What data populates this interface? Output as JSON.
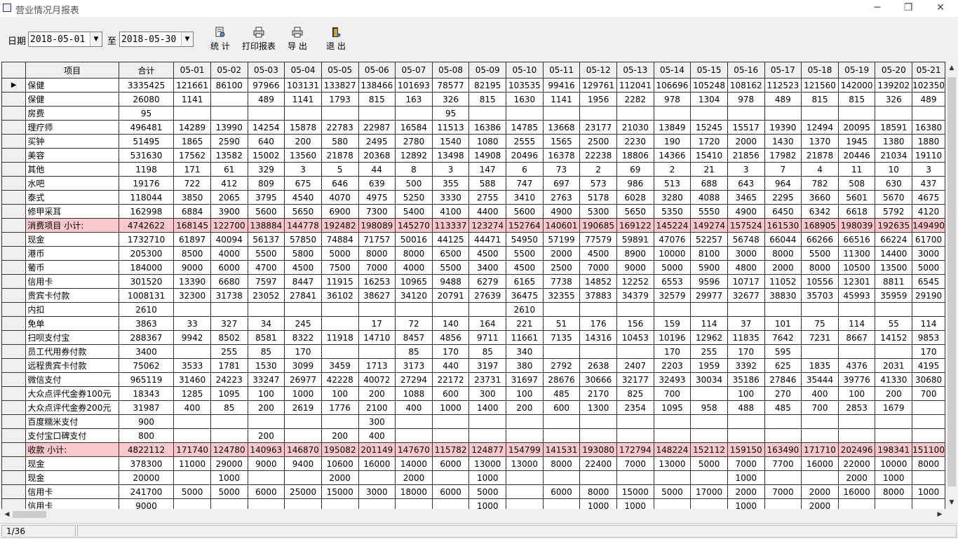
{
  "window": {
    "title": "营业情况月报表",
    "min_glyph": "─",
    "max_glyph": "❐",
    "close_glyph": "✕"
  },
  "toolbar": {
    "date_label": "日期",
    "to_label": "至",
    "start_date": "2018-05-01",
    "end_date": "2018-05-30",
    "stats_label": "统 计",
    "print_label": "打印报表",
    "export_label": "导 出",
    "exit_label": "退 出"
  },
  "table": {
    "headers": [
      "项目",
      "合计",
      "05-01",
      "05-02",
      "05-03",
      "05-04",
      "05-05",
      "05-06",
      "05-07",
      "05-08",
      "05-09",
      "05-10",
      "05-11",
      "05-12",
      "05-13",
      "05-14",
      "05-15",
      "05-16",
      "05-17",
      "05-18",
      "05-19",
      "05-20",
      "05-21"
    ],
    "current_row_marker": "▶",
    "rows": [
      {
        "name": "保健",
        "sub": false,
        "cells": [
          "3335425",
          "121661",
          "86100",
          "97966",
          "103131",
          "133827",
          "138466",
          "101693",
          "78577",
          "82195",
          "103535",
          "99416",
          "129761",
          "112041",
          "106696",
          "105248",
          "108162",
          "112523",
          "121560",
          "142000",
          "139202",
          "102350"
        ]
      },
      {
        "name": "保健",
        "sub": false,
        "cells": [
          "26080",
          "1141",
          "",
          "489",
          "1141",
          "1793",
          "815",
          "163",
          "326",
          "815",
          "1630",
          "1141",
          "1956",
          "2282",
          "978",
          "1304",
          "978",
          "489",
          "815",
          "815",
          "326",
          "489"
        ]
      },
      {
        "name": "房费",
        "sub": false,
        "cells": [
          "95",
          "",
          "",
          "",
          "",
          "",
          "",
          "",
          "95",
          "",
          "",
          "",
          "",
          "",
          "",
          "",
          "",
          "",
          "",
          "",
          "",
          ""
        ]
      },
      {
        "name": "理疗师",
        "sub": false,
        "cells": [
          "496481",
          "14289",
          "13990",
          "14254",
          "15878",
          "22783",
          "22987",
          "16584",
          "11513",
          "16386",
          "14785",
          "13668",
          "23177",
          "21030",
          "13849",
          "15245",
          "15517",
          "19390",
          "12494",
          "20095",
          "18591",
          "16380"
        ]
      },
      {
        "name": "买钟",
        "sub": false,
        "cells": [
          "51495",
          "1865",
          "2590",
          "640",
          "200",
          "580",
          "2495",
          "2780",
          "1540",
          "1080",
          "2555",
          "1565",
          "2500",
          "2230",
          "190",
          "1720",
          "2000",
          "1430",
          "1370",
          "1945",
          "1380",
          "1880"
        ]
      },
      {
        "name": "美容",
        "sub": false,
        "cells": [
          "531630",
          "17562",
          "13582",
          "15002",
          "13560",
          "21878",
          "20368",
          "12892",
          "13498",
          "14908",
          "20496",
          "16378",
          "22238",
          "18806",
          "14366",
          "15410",
          "21856",
          "17982",
          "21878",
          "20446",
          "21034",
          "19110"
        ]
      },
      {
        "name": "其他",
        "sub": false,
        "cells": [
          "1198",
          "171",
          "61",
          "329",
          "3",
          "5",
          "44",
          "8",
          "3",
          "147",
          "6",
          "73",
          "2",
          "69",
          "2",
          "21",
          "3",
          "7",
          "4",
          "11",
          "10",
          "3"
        ]
      },
      {
        "name": "水吧",
        "sub": false,
        "cells": [
          "19176",
          "722",
          "412",
          "809",
          "675",
          "646",
          "639",
          "500",
          "355",
          "588",
          "747",
          "697",
          "573",
          "986",
          "513",
          "688",
          "643",
          "964",
          "782",
          "508",
          "630",
          "437"
        ]
      },
      {
        "name": "泰式",
        "sub": false,
        "cells": [
          "118044",
          "3850",
          "2065",
          "3795",
          "4540",
          "4070",
          "4975",
          "5250",
          "3330",
          "2755",
          "3410",
          "2763",
          "5178",
          "6028",
          "3280",
          "4088",
          "3465",
          "2295",
          "3660",
          "5601",
          "5670",
          "4675"
        ]
      },
      {
        "name": "修甲采耳",
        "sub": false,
        "cells": [
          "162998",
          "6884",
          "3900",
          "5600",
          "5650",
          "6900",
          "7300",
          "5400",
          "4100",
          "4400",
          "5600",
          "4900",
          "5300",
          "5650",
          "5350",
          "5550",
          "4900",
          "6450",
          "6342",
          "6618",
          "5792",
          "4120"
        ]
      },
      {
        "name": "消费项目  小计:",
        "sub": true,
        "cells": [
          "4742622",
          "168145",
          "122700",
          "138884",
          "144778",
          "192482",
          "198089",
          "145270",
          "113337",
          "123274",
          "152764",
          "140601",
          "190685",
          "169122",
          "145224",
          "149274",
          "157524",
          "161530",
          "168905",
          "198039",
          "192635",
          "149490"
        ]
      },
      {
        "name": "现金",
        "sub": false,
        "cells": [
          "1732710",
          "61897",
          "40094",
          "56137",
          "57850",
          "74884",
          "71757",
          "50016",
          "44125",
          "44471",
          "54950",
          "57199",
          "77579",
          "59891",
          "47076",
          "52257",
          "56748",
          "66044",
          "66266",
          "66516",
          "66224",
          "61700"
        ]
      },
      {
        "name": "港币",
        "sub": false,
        "cells": [
          "205300",
          "8500",
          "4000",
          "5500",
          "5800",
          "5000",
          "8000",
          "8000",
          "6500",
          "4500",
          "5500",
          "2000",
          "4500",
          "8900",
          "10000",
          "8100",
          "3000",
          "8000",
          "5500",
          "11300",
          "14400",
          "3000"
        ]
      },
      {
        "name": "葡币",
        "sub": false,
        "cells": [
          "184000",
          "9000",
          "6000",
          "4700",
          "4500",
          "7500",
          "7000",
          "4000",
          "5500",
          "3400",
          "4500",
          "2500",
          "7000",
          "9000",
          "5000",
          "5900",
          "4800",
          "2000",
          "8000",
          "10500",
          "13500",
          "5000"
        ]
      },
      {
        "name": "信用卡",
        "sub": false,
        "cells": [
          "301520",
          "13390",
          "6680",
          "7597",
          "8447",
          "11915",
          "16253",
          "10965",
          "9488",
          "6279",
          "6165",
          "7738",
          "14852",
          "12252",
          "6553",
          "9596",
          "10717",
          "11052",
          "10556",
          "12301",
          "8811",
          "6545"
        ]
      },
      {
        "name": "贵宾卡付款",
        "sub": false,
        "cells": [
          "1008131",
          "32300",
          "31738",
          "23052",
          "27841",
          "36102",
          "38627",
          "34120",
          "20791",
          "27639",
          "36475",
          "32355",
          "37883",
          "34379",
          "32579",
          "29977",
          "32677",
          "38830",
          "35703",
          "45993",
          "35959",
          "29190"
        ]
      },
      {
        "name": "内扣",
        "sub": false,
        "cells": [
          "2610",
          "",
          "",
          "",
          "",
          "",
          "",
          "",
          "",
          "",
          "2610",
          "",
          "",
          "",
          "",
          "",
          "",
          "",
          "",
          "",
          "",
          ""
        ]
      },
      {
        "name": "免单",
        "sub": false,
        "cells": [
          "3863",
          "33",
          "327",
          "34",
          "245",
          "",
          "17",
          "72",
          "140",
          "164",
          "221",
          "51",
          "176",
          "156",
          "159",
          "114",
          "37",
          "101",
          "75",
          "114",
          "55",
          "114"
        ]
      },
      {
        "name": "扫呗支付宝",
        "sub": false,
        "cells": [
          "288367",
          "9942",
          "8502",
          "8581",
          "8322",
          "11918",
          "14710",
          "8457",
          "4856",
          "9711",
          "11661",
          "7135",
          "14316",
          "10453",
          "10196",
          "12962",
          "11835",
          "7642",
          "7231",
          "8667",
          "14152",
          "9853"
        ]
      },
      {
        "name": "员工代用券付款",
        "sub": false,
        "cells": [
          "3400",
          "",
          "255",
          "85",
          "170",
          "",
          "",
          "85",
          "170",
          "85",
          "340",
          "",
          "",
          "",
          "170",
          "255",
          "170",
          "595",
          "",
          "",
          "",
          "170"
        ]
      },
      {
        "name": "远程贵宾卡付款",
        "sub": false,
        "cells": [
          "75062",
          "3533",
          "1781",
          "1530",
          "3099",
          "3459",
          "1713",
          "3173",
          "440",
          "3197",
          "380",
          "2792",
          "2638",
          "2407",
          "2203",
          "1959",
          "3392",
          "625",
          "1835",
          "4376",
          "2031",
          "4195"
        ]
      },
      {
        "name": "微信支付",
        "sub": false,
        "cells": [
          "965119",
          "31460",
          "24223",
          "33247",
          "26977",
          "42228",
          "40072",
          "27294",
          "22172",
          "23731",
          "31697",
          "28676",
          "30666",
          "32177",
          "32493",
          "30034",
          "35186",
          "27846",
          "35444",
          "39776",
          "41330",
          "30680"
        ]
      },
      {
        "name": "大众点评代金券100元",
        "sub": false,
        "cells": [
          "18343",
          "1285",
          "1095",
          "100",
          "1000",
          "100",
          "200",
          "1088",
          "600",
          "300",
          "100",
          "485",
          "2170",
          "825",
          "700",
          "",
          "100",
          "270",
          "400",
          "100",
          "200",
          "700"
        ]
      },
      {
        "name": "大众点评代金券200元",
        "sub": false,
        "cells": [
          "31987",
          "400",
          "85",
          "200",
          "2619",
          "1776",
          "2100",
          "400",
          "1000",
          "1400",
          "200",
          "600",
          "1300",
          "2354",
          "1095",
          "958",
          "488",
          "485",
          "700",
          "2853",
          "1679",
          ""
        ]
      },
      {
        "name": "百度糯米支付",
        "sub": false,
        "cells": [
          "900",
          "",
          "",
          "",
          "",
          "",
          "300",
          "",
          "",
          "",
          "",
          "",
          "",
          "",
          "",
          "",
          "",
          "",
          "",
          "",
          "",
          ""
        ]
      },
      {
        "name": "支付宝口碑支付",
        "sub": false,
        "cells": [
          "800",
          "",
          "",
          "200",
          "",
          "200",
          "400",
          "",
          "",
          "",
          "",
          "",
          "",
          "",
          "",
          "",
          "",
          "",
          "",
          "",
          "",
          ""
        ]
      },
      {
        "name": "收款  小计:",
        "sub": true,
        "cells": [
          "4822112",
          "171740",
          "124780",
          "140963",
          "146870",
          "195082",
          "201149",
          "147670",
          "115782",
          "124877",
          "154799",
          "141531",
          "193080",
          "172794",
          "148224",
          "152112",
          "159150",
          "163490",
          "171710",
          "202496",
          "198341",
          "151100"
        ]
      },
      {
        "name": "现金",
        "sub": false,
        "cells": [
          "378300",
          "11000",
          "29000",
          "9000",
          "9400",
          "10600",
          "16000",
          "14000",
          "6000",
          "13000",
          "13000",
          "8000",
          "22400",
          "7000",
          "13000",
          "5000",
          "7000",
          "7700",
          "16000",
          "22000",
          "10000",
          "8000"
        ]
      },
      {
        "name": "现金",
        "sub": false,
        "cells": [
          "20000",
          "",
          "1000",
          "",
          "",
          "2000",
          "",
          "2000",
          "",
          "1000",
          "",
          "",
          "",
          "",
          "",
          "",
          "1000",
          "",
          "",
          "2000",
          "1000",
          ""
        ]
      },
      {
        "name": "信用卡",
        "sub": false,
        "cells": [
          "241700",
          "5000",
          "5000",
          "6000",
          "25000",
          "15000",
          "3000",
          "18000",
          "6000",
          "5000",
          "",
          "6000",
          "8000",
          "15000",
          "5000",
          "17000",
          "2000",
          "7000",
          "2000",
          "16000",
          "8000",
          "1000"
        ]
      },
      {
        "name": "信用卡",
        "sub": false,
        "cells": [
          "9000",
          "",
          "",
          "",
          "",
          "",
          "",
          "",
          "",
          "1000",
          "",
          "",
          "1000",
          "1000",
          "",
          "",
          "1000",
          "",
          "2000",
          "",
          "",
          ""
        ]
      }
    ]
  },
  "status": {
    "record": "1/36"
  }
}
